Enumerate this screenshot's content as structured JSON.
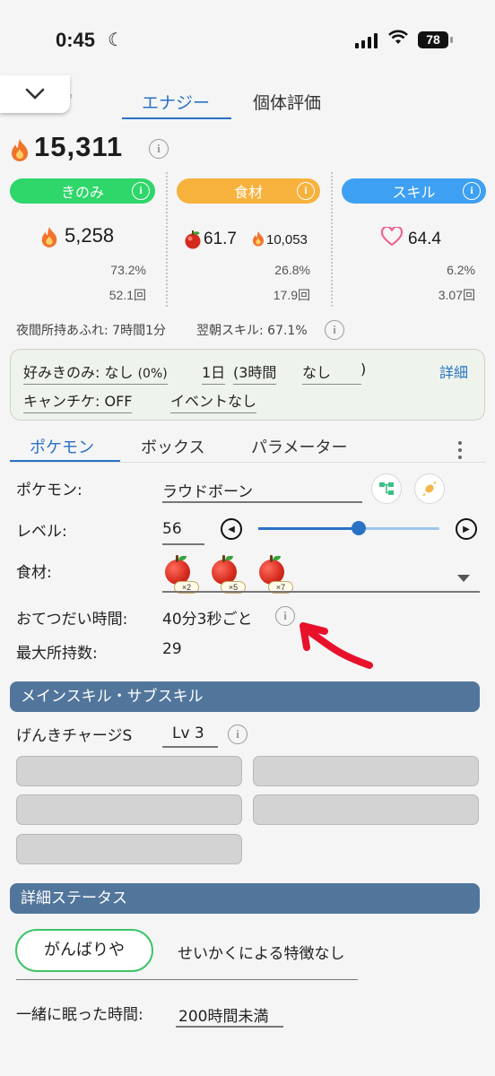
{
  "status_bar": {
    "time": "0:45",
    "battery": "78"
  },
  "top_tabs": {
    "energy": "エナジー",
    "evaluation": "個体評価"
  },
  "total_energy": "15,311",
  "categories": {
    "berry": {
      "label": "きのみ",
      "energy": "5,258",
      "percent": "73.2%",
      "count": "52.1回"
    },
    "ingredient": {
      "label": "食材",
      "amount": "61.7",
      "energy": "10,053",
      "percent": "26.8%",
      "count": "17.9回"
    },
    "skill": {
      "label": "スキル",
      "value": "64.4",
      "percent": "6.2%",
      "count": "3.07回"
    }
  },
  "notes": {
    "overflow": "夜間所持あふれ: 7時間1分",
    "morning_skill": "翌朝スキル: 67.1%"
  },
  "settings": {
    "favorite_berry": "好みきのみ: なし",
    "favorite_pct": "(0%)",
    "period": "1日",
    "interval": "(3時間",
    "interval_mode": "なし",
    "interval_close": ")",
    "candy_ticket": "キャンチケ: OFF",
    "event": "イベントなし",
    "detail": "詳細"
  },
  "sub_tabs": {
    "pokemon": "ポケモン",
    "box": "ボックス",
    "parameter": "パラメーター"
  },
  "pokemon_form": {
    "pokemon_label": "ポケモン:",
    "pokemon_value": "ラウドボーン",
    "level_label": "レベル:",
    "level_value": "56",
    "level": 56,
    "ingredient_label": "食材:",
    "ingredients": [
      {
        "name": "apple-icon",
        "qty": "×2"
      },
      {
        "name": "apple-icon",
        "qty": "×5"
      },
      {
        "name": "apple-icon",
        "qty": "×7"
      }
    ],
    "help_time_label": "おてつだい時間:",
    "help_time_value": "40分3秒ごと",
    "max_carry_label": "最大所持数:",
    "max_carry_value": "29"
  },
  "skill_section": {
    "title": "メインスキル・サブスキル",
    "main_skill": "げんきチャージS",
    "main_skill_level": "Lv 3"
  },
  "detail_section": {
    "title": "詳細ステータス",
    "nature": "がんばりや",
    "nature_effect": "せいかくによる特徴なし",
    "sleep_label": "一緒に眠った時間:",
    "sleep_value": "200時間未満"
  },
  "colors": {
    "accent": "#2a72c4",
    "berry": "#2fd66a",
    "ingredient": "#f7b23d",
    "skill": "#3ea0f2",
    "section": "#52769b",
    "annotation_arrow": "#e8102a"
  }
}
